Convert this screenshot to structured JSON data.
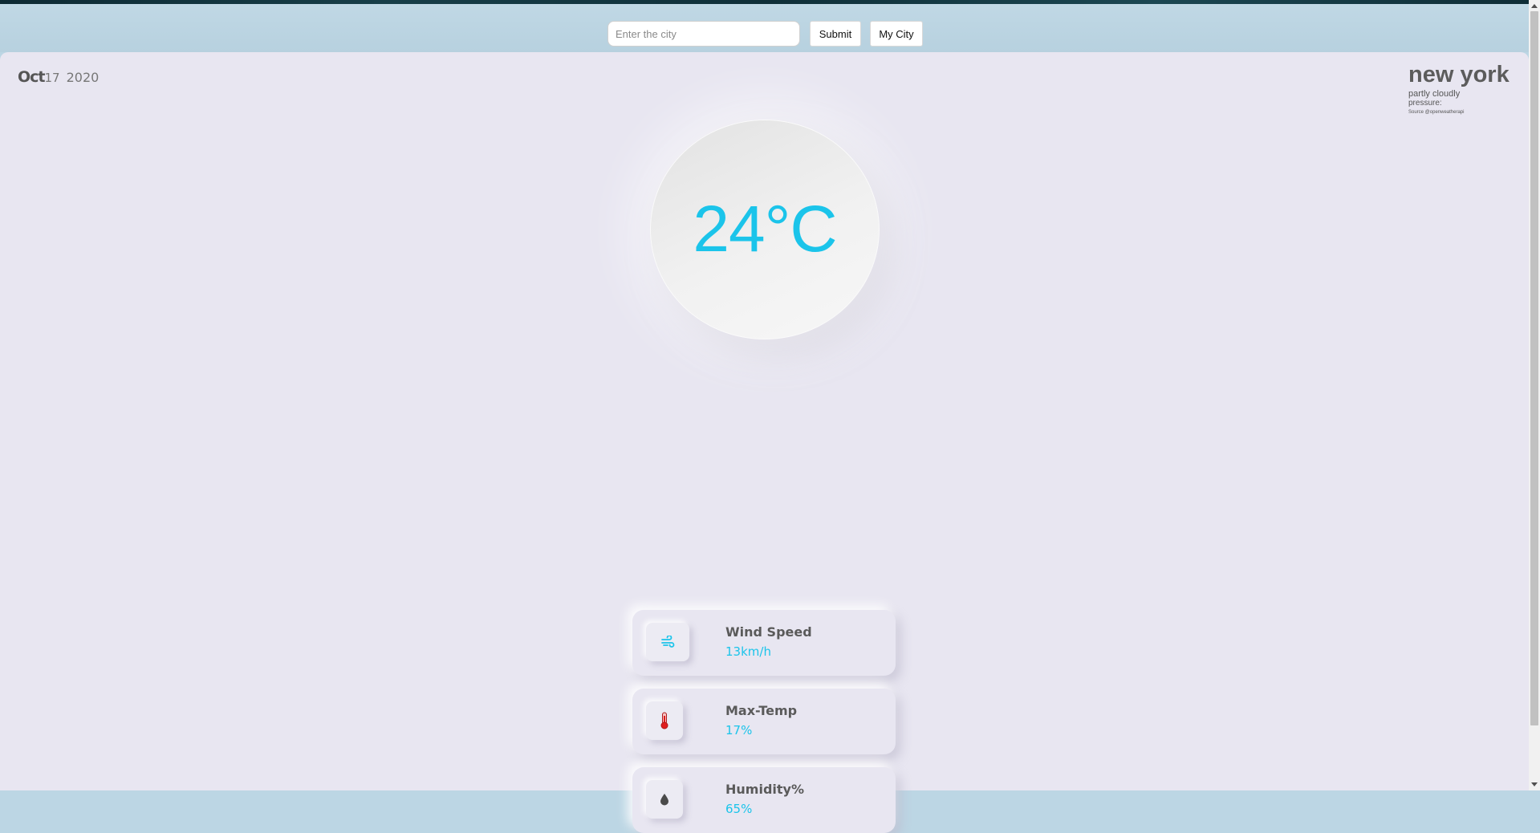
{
  "search": {
    "placeholder": "Enter the city",
    "value": "",
    "submit_label": "Submit",
    "mycity_label": "My City"
  },
  "date": {
    "month": "Oct",
    "day": "17",
    "year": "2020"
  },
  "location": {
    "city": "new york",
    "description": "partly cloudly",
    "pressure_label": "pressure:",
    "source": "Source @openweatherapi"
  },
  "current": {
    "temperature": "24°C"
  },
  "stats": [
    {
      "label": "Wind Speed",
      "value": "13km/h",
      "icon": "wind-icon"
    },
    {
      "label": "Max-Temp",
      "value": "17%",
      "icon": "thermometer-icon"
    },
    {
      "label": "Humidity%",
      "value": "65%",
      "icon": "droplet-icon"
    }
  ],
  "colors": {
    "accent": "#1bc4ea",
    "background": "#e8e6f1",
    "header": "#bcd6e4",
    "thermometer": "#e01e1e"
  }
}
